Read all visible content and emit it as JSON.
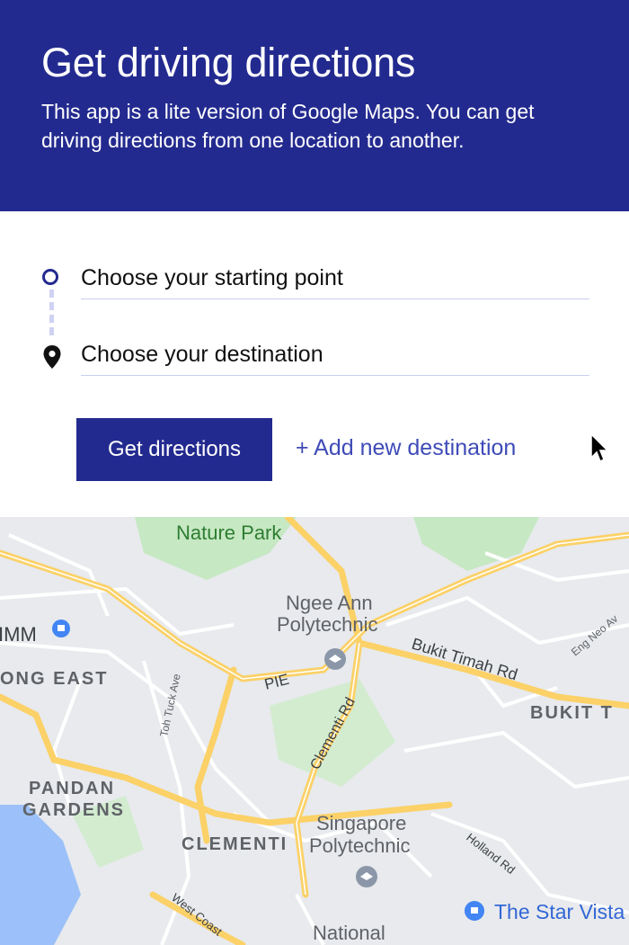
{
  "header": {
    "title": "Get driving directions",
    "description": "This app is a lite version of Google Maps. You can get driving directions from one location to another."
  },
  "form": {
    "start_placeholder": "Choose your starting point",
    "destination_placeholder": "Choose your destination",
    "submit_label": "Get directions",
    "add_destination_label": "+ Add new destination"
  },
  "map": {
    "labels": {
      "nature_park": "Nature Park",
      "ngee_ann_1": "Ngee Ann",
      "ngee_ann_2": "Polytechnic",
      "imm": "IMM",
      "jurong_east": "ONG EAST",
      "bukit_timah_rd": "Bukit Timah Rd",
      "pie": "PIE",
      "toh_tuck": "Toh Tuck Ave",
      "clementi_rd": "Clementi Rd",
      "bukit_t": "BUKIT T",
      "eng_neo": "Eng Neo Av",
      "pandan_1": "PANDAN",
      "pandan_2": "GARDENS",
      "clementi": "CLEMENTI",
      "sp_1": "Singapore",
      "sp_2": "Polytechnic",
      "holland_rd": "Holland Rd",
      "star_vista": "The Star Vista",
      "west_coast": "West Coast",
      "national": "National"
    },
    "colors": {
      "land": "#e8eaed",
      "park": "#c6e8c3",
      "water": "#9cc0f9",
      "highway": "#fbd168",
      "road": "#ffffff",
      "pin": "#4285f4"
    }
  }
}
